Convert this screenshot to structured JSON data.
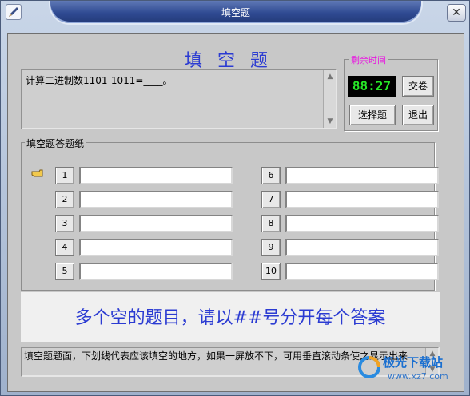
{
  "window": {
    "title": "填空题"
  },
  "heading": "填 空 题",
  "question": {
    "text": "计算二进制数1101-1011=____。"
  },
  "timer": {
    "legend": "剩余时间",
    "value": "88:27",
    "submit_label": "交卷",
    "choice_label": "选择题",
    "exit_label": "退出"
  },
  "sheet": {
    "legend": "填空题答题纸",
    "left": [
      {
        "num": "1",
        "value": ""
      },
      {
        "num": "2",
        "value": ""
      },
      {
        "num": "3",
        "value": ""
      },
      {
        "num": "4",
        "value": ""
      },
      {
        "num": "5",
        "value": ""
      }
    ],
    "right": [
      {
        "num": "6",
        "value": ""
      },
      {
        "num": "7",
        "value": ""
      },
      {
        "num": "8",
        "value": ""
      },
      {
        "num": "9",
        "value": ""
      },
      {
        "num": "10",
        "value": ""
      }
    ]
  },
  "hint": "多个空的题目，请以##号分开每个答案",
  "status": "填空题题面，下划线代表应该填空的地方，如果一屏放不下，可用垂直滚动条使之显示出来",
  "watermark": {
    "name": "极光下载站",
    "url": "www.xz7.com"
  },
  "colors": {
    "accent": "#2b3bd2",
    "timer_fg": "#26e626",
    "legend": "#e818e0"
  }
}
